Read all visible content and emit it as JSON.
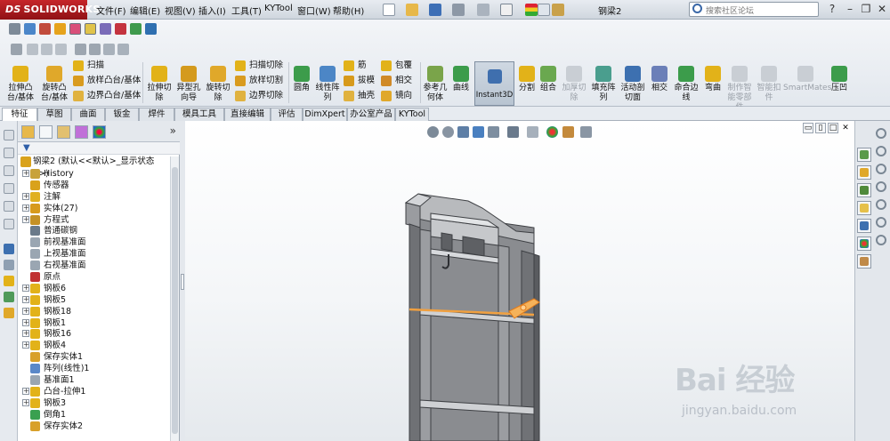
{
  "app": {
    "brand": "SOLIDWORKS",
    "brand_prefix": "DS",
    "document_title": "钢梁2",
    "search_placeholder": "搜索社区论坛",
    "menu": [
      "文件(F)",
      "编辑(E)",
      "视图(V)",
      "插入(I)",
      "工具(T)",
      "KYTool",
      "窗口(W)",
      "帮助(H)"
    ]
  },
  "ribbon": {
    "big_buttons": [
      {
        "label": "拉伸凸\n台/基体"
      },
      {
        "label": "旋转凸\n台/基体"
      },
      {
        "label": "拉伸切\n除"
      },
      {
        "label": "异型孔\n向导"
      },
      {
        "label": "旋转切\n除"
      },
      {
        "label": "圆角"
      },
      {
        "label": "线性阵\n列"
      },
      {
        "label": "参考几\n何体"
      },
      {
        "label": "曲线"
      },
      {
        "label": "分割"
      },
      {
        "label": "组合"
      },
      {
        "label": "加厚切\n除"
      },
      {
        "label": "填充阵\n列"
      },
      {
        "label": "活动剖\n切面"
      },
      {
        "label": "相交"
      },
      {
        "label": "命合边\n线"
      },
      {
        "label": "弯曲"
      },
      {
        "label": "制作智\n能零部\n件"
      },
      {
        "label": "智能扣\n件"
      },
      {
        "label": "SmartMates"
      },
      {
        "label": "压凹"
      }
    ],
    "small_buttons": {
      "col1": [
        "扫描",
        "放样凸台/基体",
        "边界凸台/基体"
      ],
      "col2": [
        "扫描切除",
        "放样切割",
        "边界切除"
      ],
      "col3": [
        "筋",
        "拔模",
        "抽壳"
      ],
      "col4": [
        "包覆",
        "相交",
        "镜向"
      ]
    },
    "instant3d": "Instant3D"
  },
  "tabs": [
    "特征",
    "草图",
    "曲面",
    "钣金",
    "焊件",
    "模具工具",
    "直接编辑",
    "评估",
    "DimXpert",
    "办公室产品",
    "KYTool"
  ],
  "tree": {
    "root": "钢梁2 (默认<<默认>_显示状态 1>)",
    "items": [
      {
        "label": "History",
        "expand": true,
        "color": "#c8a23a"
      },
      {
        "label": "传感器",
        "expand": false,
        "color": "#d9a21b"
      },
      {
        "label": "注解",
        "expand": true,
        "color": "#e0b020"
      },
      {
        "label": "实体(27)",
        "expand": true,
        "color": "#d79a1c"
      },
      {
        "label": "方程式",
        "expand": true,
        "color": "#c49126"
      },
      {
        "label": "普通碳钢",
        "expand": false,
        "color": "#6a7a8a"
      },
      {
        "label": "前视基准面",
        "expand": false,
        "color": "#9aa6b2"
      },
      {
        "label": "上视基准面",
        "expand": false,
        "color": "#9aa6b2"
      },
      {
        "label": "右视基准面",
        "expand": false,
        "color": "#9aa6b2"
      },
      {
        "label": "原点",
        "expand": false,
        "color": "#c03030"
      },
      {
        "label": "钢板6",
        "expand": true,
        "color": "#e2b219"
      },
      {
        "label": "钢板5",
        "expand": true,
        "color": "#e2b219"
      },
      {
        "label": "钢板18",
        "expand": true,
        "color": "#e2b219"
      },
      {
        "label": "钢板1",
        "expand": true,
        "color": "#e2b219"
      },
      {
        "label": "钢板16",
        "expand": true,
        "color": "#e2b219"
      },
      {
        "label": "钢板4",
        "expand": true,
        "color": "#e2b219"
      },
      {
        "label": "保存实体1",
        "expand": false,
        "color": "#d8a02a"
      },
      {
        "label": "阵列(线性)1",
        "expand": false,
        "color": "#5a88c8"
      },
      {
        "label": "基准面1",
        "expand": false,
        "color": "#9aa6b2"
      },
      {
        "label": "凸台-拉伸1",
        "expand": true,
        "color": "#e2b219"
      },
      {
        "label": "钢板3",
        "expand": true,
        "color": "#e2b219"
      },
      {
        "label": "倒角1",
        "expand": false,
        "color": "#3aa050"
      },
      {
        "label": "保存实体2",
        "expand": false,
        "color": "#d8a02a"
      }
    ]
  },
  "colors": {
    "brand_red": "#b01c20",
    "model_gray": "#7d7f84",
    "highlight_orange": "#f0a040"
  },
  "watermark": {
    "logo": "Bai 经验",
    "url": "jingyan.baidu.com"
  }
}
